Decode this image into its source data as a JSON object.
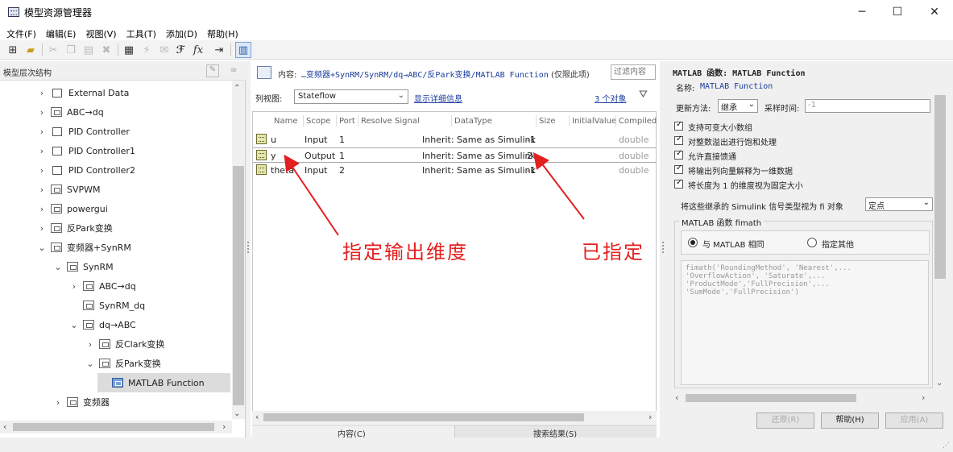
{
  "window": {
    "title": "模型资源管理器",
    "minimize": "─",
    "maximize": "☐",
    "close": "✕"
  },
  "menu": [
    "文件(F)",
    "编辑(E)",
    "视图(V)",
    "工具(T)",
    "添加(D)",
    "帮助(H)"
  ],
  "left": {
    "header": "模型层次结构",
    "tree": [
      {
        "label": "External Data",
        "arrow": "›",
        "indent": 0,
        "icon": "ctrl"
      },
      {
        "label": "ABC→dq",
        "arrow": "›",
        "indent": 0,
        "icon": "sub"
      },
      {
        "label": "PID Controller",
        "arrow": "›",
        "indent": 0,
        "icon": "ctrl"
      },
      {
        "label": "PID Controller1",
        "arrow": "›",
        "indent": 0,
        "icon": "ctrl"
      },
      {
        "label": "PID Controller2",
        "arrow": "›",
        "indent": 0,
        "icon": "ctrl"
      },
      {
        "label": "SVPWM",
        "arrow": "›",
        "indent": 0,
        "icon": "sub"
      },
      {
        "label": "powergui",
        "arrow": "›",
        "indent": 0,
        "icon": "sub"
      },
      {
        "label": "反Park变换",
        "arrow": "›",
        "indent": 0,
        "icon": "sub"
      },
      {
        "label": "变频器+SynRM",
        "arrow": "⌄",
        "indent": 0,
        "icon": "sub"
      },
      {
        "label": "SynRM",
        "arrow": "⌄",
        "indent": 1,
        "icon": "sub"
      },
      {
        "label": "ABC→dq",
        "arrow": "›",
        "indent": 2,
        "icon": "sub"
      },
      {
        "label": "SynRM_dq",
        "arrow": "",
        "indent": 2,
        "icon": "sub"
      },
      {
        "label": "dq→ABC",
        "arrow": "⌄",
        "indent": 2,
        "icon": "sub"
      },
      {
        "label": "反Clark变换",
        "arrow": "›",
        "indent": 3,
        "icon": "sub"
      },
      {
        "label": "反Park变换",
        "arrow": "⌄",
        "indent": 3,
        "icon": "sub"
      },
      {
        "label": "MATLAB Function",
        "arrow": "",
        "indent": 4,
        "icon": "fn",
        "selected": true
      },
      {
        "label": "变频器",
        "arrow": "›",
        "indent": 1,
        "icon": "sub"
      }
    ]
  },
  "middle": {
    "content_label": "内容:",
    "content_path": "…变频器+SynRM/SynRM/dq→ABC/反Park变换/MATLAB Function",
    "content_note": "(仅限此项)",
    "filter_placeholder": "过滤内容",
    "view_label": "列视图:",
    "view_value": "Stateflow",
    "detail_link": "显示详细信息",
    "objects_link": "3 个对象",
    "columns": [
      "Name",
      "Scope",
      "Port",
      "Resolve Signal",
      "DataType",
      "Size",
      "InitialValue",
      "Compiled"
    ],
    "rows": [
      {
        "name": "u",
        "scope": "Input",
        "port": "1",
        "datatype": "Inherit: Same as Simulink",
        "size": "-1",
        "compiled": "double"
      },
      {
        "name": "y",
        "scope": "Output",
        "port": "1",
        "datatype": "Inherit: Same as Simulink",
        "size": "2",
        "compiled": "double"
      },
      {
        "name": "theta",
        "scope": "Input",
        "port": "2",
        "datatype": "Inherit: Same as Simulink",
        "size": "-1",
        "compiled": "double"
      }
    ],
    "tabs": [
      "内容(C)",
      "搜索结果(S)"
    ]
  },
  "right": {
    "heading": "MATLAB 函数: MATLAB Function",
    "name_label": "名称:",
    "name_value": "MATLAB Function",
    "update_label": "更新方法:",
    "update_value": "继承",
    "sample_label": "采样时间:",
    "sample_value": "-1",
    "checks": [
      "支持可变大小数组",
      "对整数溢出进行饱和处理",
      "允许直接馈通",
      "将输出列向量解释为一维数据",
      "将长度为 1 的维度视为固定大小"
    ],
    "fi_label": "将这些继承的 Simulink 信号类型视为 fi 对象",
    "fi_value": "定点",
    "fimath_group": "MATLAB 函数 fimath",
    "radio_same": "与 MATLAB 相同",
    "radio_other": "指定其他",
    "fimath_code": "fimath('RoundingMethod', 'Nearest',...\n'OverflowAction', 'Saturate',...\n'ProductMode','FullPrecision',...\n'SumMode','FullPrecision')",
    "btn_revert": "还原(R)",
    "btn_help": "帮助(H)",
    "btn_apply": "应用(A)"
  },
  "annotations": {
    "left": "指定输出维度",
    "right": "已指定"
  },
  "colors": {
    "annotation": "#e32020",
    "link": "#1a3d9c"
  }
}
